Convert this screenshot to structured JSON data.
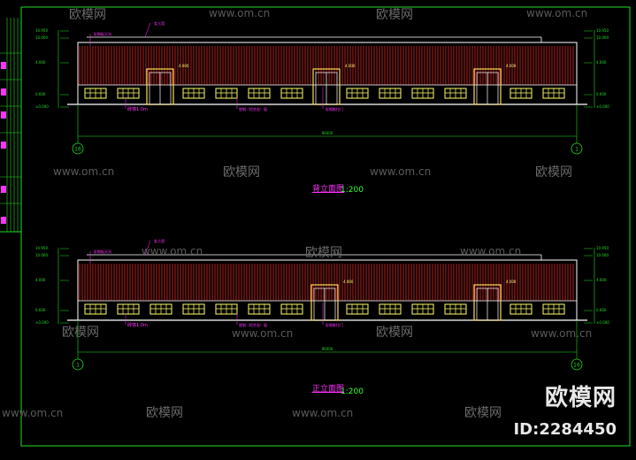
{
  "colors": {
    "background": "#000000",
    "frame": "#22dd22",
    "wall_outline": "#ffffff",
    "roof_stripe": "#cc2222",
    "window": "#ffff66",
    "door": "#ffdd55",
    "dimension": "#22dd22",
    "annotation": "#ff33ff",
    "caption": "#ff33ff",
    "scale": "#33ff33"
  },
  "drawings": [
    {
      "id": "rear",
      "caption": "背立面图",
      "scale": "1:200",
      "axis_left": "16",
      "axis_right": "1",
      "total_dim": "96000",
      "label_gutter": "彩钢板天沟",
      "label_parapet": "女儿墙",
      "label_brick": "砖墙1.0m",
      "label_window": "塑钢（铝合金）窗",
      "label_door": "彩钢推拉门",
      "elevations_left": [
        "10.950",
        "10.000",
        "4.000",
        "0.600",
        "±0.000"
      ],
      "elevations_right": [
        "10.950",
        "10.000",
        "4.000",
        "0.600",
        "±0.000"
      ],
      "door_marks": [
        "4.000",
        "4.000",
        "4.000"
      ]
    },
    {
      "id": "front",
      "caption": "正立面图",
      "scale": "1:200",
      "axis_left": "1",
      "axis_right": "16",
      "total_dim": "96000",
      "label_gutter": "彩钢板天沟",
      "label_parapet": "女儿墙",
      "label_brick": "砖墙1.0m",
      "label_window": "塑钢（铝合金）窗",
      "label_door": "彩钢推拉门",
      "elevations_left": [
        "10.950",
        "10.000",
        "4.000",
        "0.600",
        "±0.000"
      ],
      "elevations_right": [
        "10.950",
        "10.000",
        "4.000",
        "0.600",
        "±0.000"
      ],
      "door_marks": [
        "4.000",
        "4.000"
      ]
    }
  ],
  "watermarks": [
    "欧模网",
    "www.om.cn"
  ],
  "brand": "欧模网",
  "brand_id": "ID:2284450"
}
